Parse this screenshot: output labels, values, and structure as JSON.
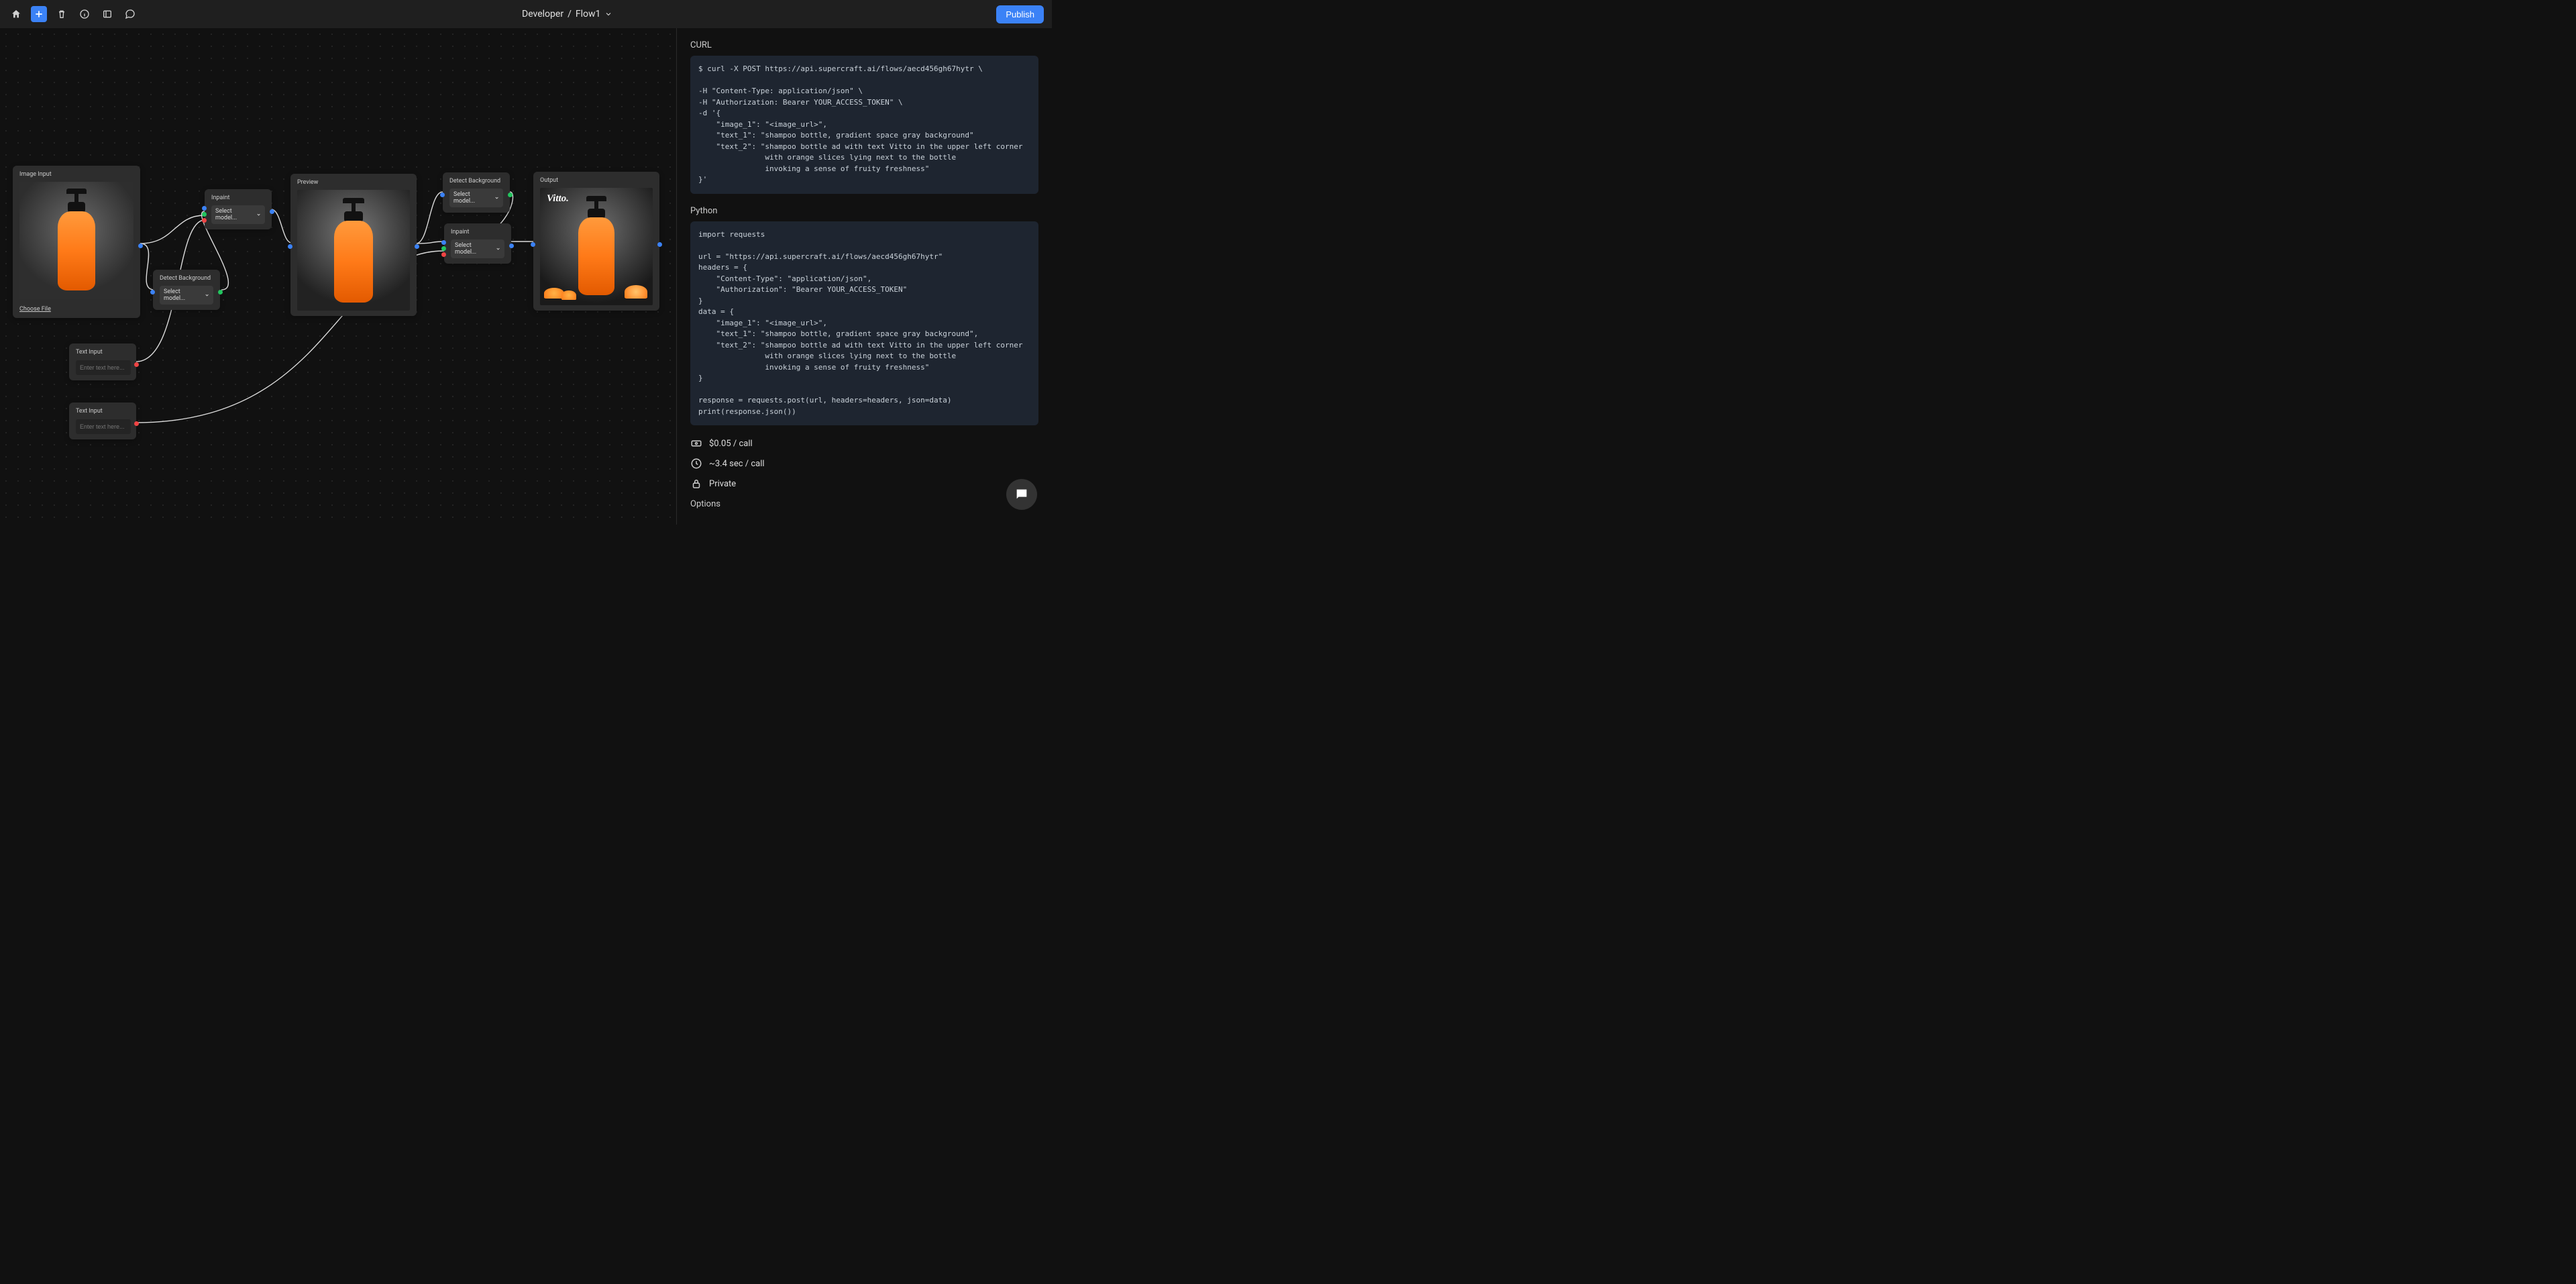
{
  "breadcrumb": {
    "workspace": "Developer",
    "flow": "Flow1"
  },
  "toolbar": {
    "publish": "Publish"
  },
  "nodes": {
    "imageInput": {
      "title": "Image Input",
      "chooseFile": "Choose File"
    },
    "inpaint1": {
      "title": "Inpaint",
      "select": "Select model..."
    },
    "detect1": {
      "title": "Detect Background",
      "select": "Select model..."
    },
    "preview": {
      "title": "Preview"
    },
    "textInput1": {
      "title": "Text Input",
      "placeholder": "Enter text here..."
    },
    "textInput2": {
      "title": "Text Input",
      "placeholder": "Enter text here..."
    },
    "detect2": {
      "title": "Detect Background",
      "select": "Select model..."
    },
    "inpaint2": {
      "title": "Inpaint",
      "select": "Select model..."
    },
    "output": {
      "title": "Output",
      "brand": "Vitto."
    }
  },
  "panel": {
    "curlHeading": "CURL",
    "curlCode": "$ curl -X POST https://api.supercraft.ai/flows/aecd456gh67hytr \\\n\n-H \"Content-Type: application/json\" \\\n-H \"Authorization: Bearer YOUR_ACCESS_TOKEN\" \\\n-d '{\n    \"image_1\": \"<image_url>\",\n    \"text_1\": \"shampoo bottle, gradient space gray background\"\n    \"text_2\": \"shampoo bottle ad with text Vitto in the upper left corner\n               with orange slices lying next to the bottle\n               invoking a sense of fruity freshness\"\n}'",
    "pythonHeading": "Python",
    "pythonCode": "import requests\n\nurl = \"https://api.supercraft.ai/flows/aecd456gh67hytr\"\nheaders = {\n    \"Content-Type\": \"application/json\",\n    \"Authorization\": \"Bearer YOUR_ACCESS_TOKEN\"\n}\ndata = {\n    \"image_1\": \"<image_url>\",\n    \"text_1\": \"shampoo bottle, gradient space gray background\",\n    \"text_2\": \"shampoo bottle ad with text Vitto in the upper left corner\n               with orange slices lying next to the bottle\n               invoking a sense of fruity freshness\"\n}\n\nresponse = requests.post(url, headers=headers, json=data)\nprint(response.json())",
    "cost": "$0.05 / call",
    "latency": "~3.4 sec / call",
    "privacy": "Private",
    "options": "Options"
  }
}
